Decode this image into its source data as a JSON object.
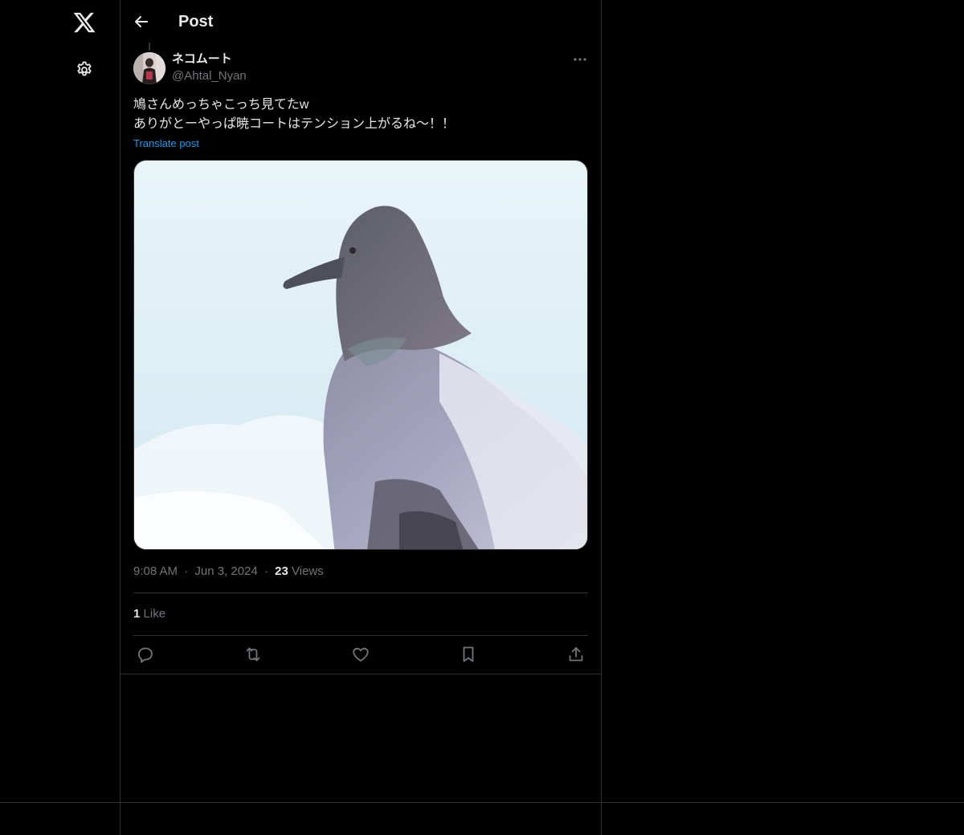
{
  "header": {
    "title": "Post"
  },
  "post": {
    "display_name": "ネコムート",
    "handle": "@Ahtal_Nyan",
    "text_lines": [
      "鳩さんめっちゃこっち見てたw",
      "ありがとーやっぱ暁コートはテンション上がるね〜！！"
    ],
    "translate_label": "Translate post",
    "time": "9:08 AM",
    "date": "Jun 3, 2024",
    "separator": "·",
    "views_count": "23",
    "views_label": "Views",
    "likes_count": "1",
    "likes_label": "Like"
  },
  "icons": {
    "logo": "x-logo-icon",
    "settings": "gear-icon",
    "back": "back-arrow-icon",
    "more": "more-horizontal-icon",
    "reply": "reply-icon",
    "repost": "repost-icon",
    "like": "heart-icon",
    "bookmark": "bookmark-icon",
    "share": "share-icon"
  },
  "colors": {
    "background": "#000000",
    "text": "#e7e9ea",
    "muted": "#71767b",
    "link": "#1d9bf0",
    "border": "#2f3336"
  }
}
